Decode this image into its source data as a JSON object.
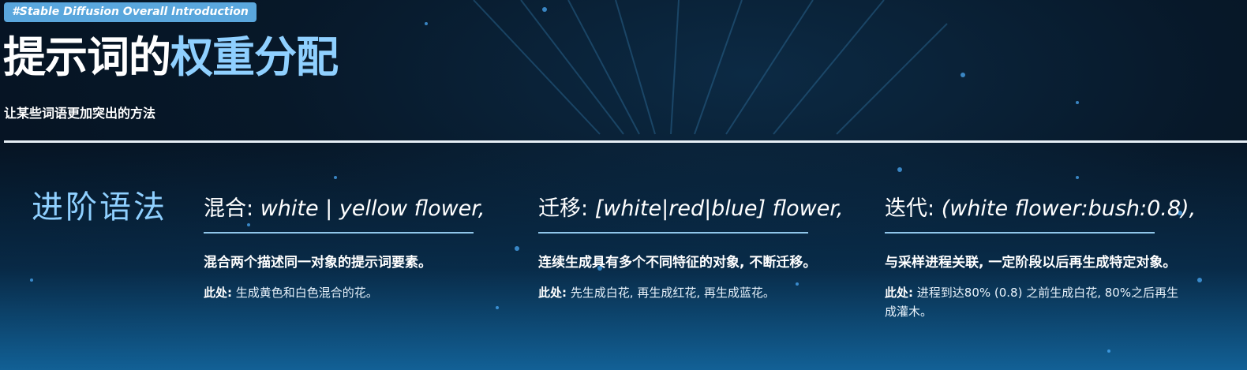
{
  "header": {
    "tag": "#Stable Diffusion Overall Introduction",
    "title_part1": "提示词的",
    "title_part2": "权重分配",
    "subtitle": "让某些词语更加突出的方法"
  },
  "section_label": "进阶语法",
  "columns": [
    {
      "heading_key": "混合:",
      "heading_expr": "white | yellow flower,",
      "description": "混合两个描述同一对象的提示词要素。",
      "note_label": "此处:",
      "note_text": "生成黄色和白色混合的花。"
    },
    {
      "heading_key": "迁移:",
      "heading_expr": "[white|red|blue] flower,",
      "description": "连续生成具有多个不同特征的对象, 不断迁移。",
      "note_label": "此处:",
      "note_text": "先生成白花, 再生成红花, 再生成蓝花。"
    },
    {
      "heading_key": "迭代:",
      "heading_expr": "(white flower:bush:0.8),",
      "description": "与采样进程关联, 一定阶段以后再生成特定对象。",
      "note_label": "此处:",
      "note_text": "进程到达80% (0.8) 之前生成白花, 80%之后再生成灌木。"
    }
  ],
  "colors": {
    "accent": "#8fd0ff",
    "tag_bg": "#5aa7dd",
    "divider": "#e6eef5"
  }
}
